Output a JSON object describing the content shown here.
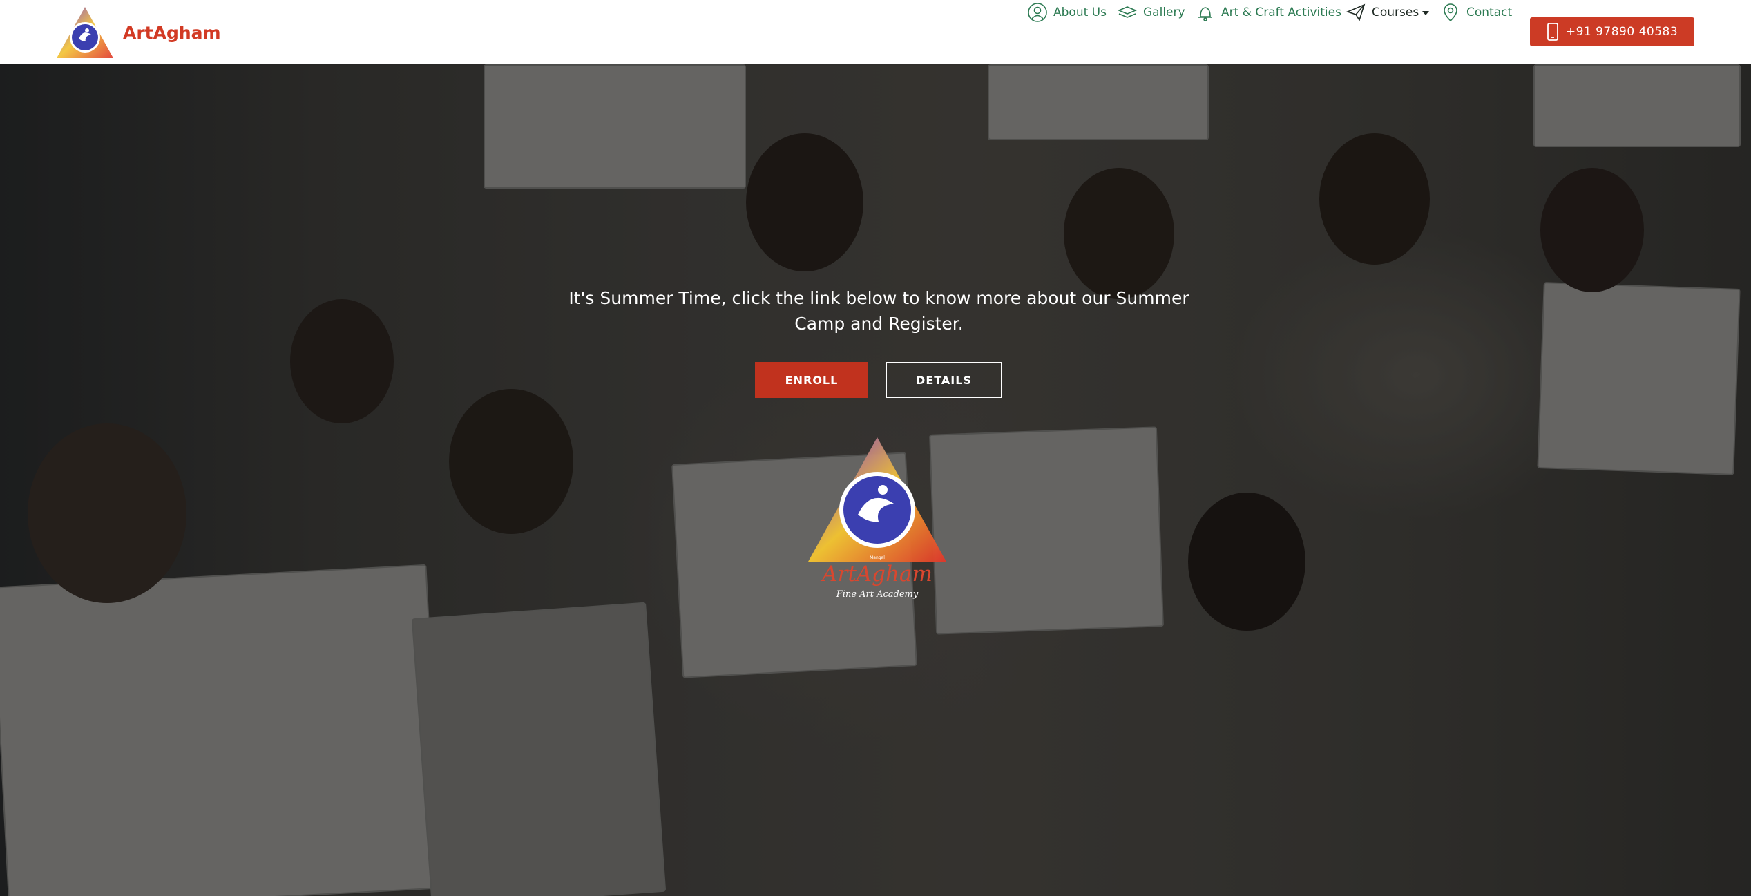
{
  "header": {
    "brand_name": "ArtAgham",
    "logo_icon": "artagham-logo",
    "nav": [
      {
        "label": "About Us",
        "icon": "user-icon"
      },
      {
        "label": "Gallery",
        "icon": "gallery-icon"
      },
      {
        "label": "Art & Craft Activities",
        "icon": "bell-icon"
      },
      {
        "label": "Courses",
        "icon": "paper-plane-icon"
      },
      {
        "label": "Contact",
        "icon": "location-pin-icon"
      }
    ],
    "phone_label": "+91 97890 40583",
    "phone_icon": "mobile-phone-icon"
  },
  "hero": {
    "message": "It's Summer Time, click the link below to know more about our Summer Camp and Register.",
    "enroll_label": "ENROLL",
    "details_label": "DETAILS",
    "logo_brand": "ArtAgham",
    "logo_subtitle": "Fine Art Academy",
    "logo_small": "Mangal"
  },
  "colors": {
    "brand_red": "#cc3b25",
    "nav_green": "#2c7a52",
    "logo_blue": "#3b3fb0"
  }
}
